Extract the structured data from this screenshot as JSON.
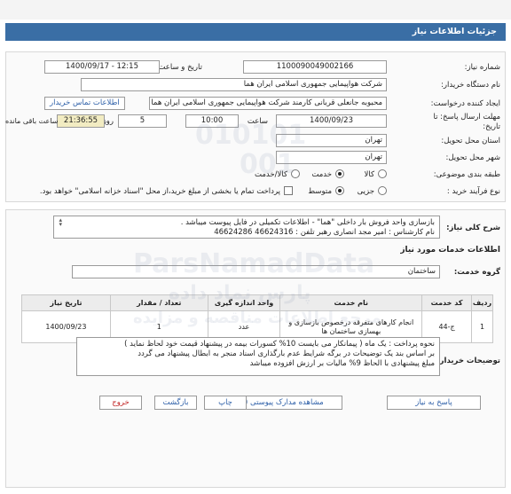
{
  "header": {
    "title": "جزئیات اطلاعات نیاز"
  },
  "form": {
    "need_number_label": "شماره نیاز:",
    "need_number": "1100090049002166",
    "announce_label": "تاریخ و ساعت اعلان عمومی:",
    "announce_value": "1400/09/17 - 12:15",
    "buyer_org_label": "نام دستگاه خریدار:",
    "buyer_org": "شرکت هواپیمایی جمهوری اسلامی ایران هما",
    "creator_label": "ایجاد کننده درخواست:",
    "creator": "محبوبه جانعلی قربانی کارمند شرکت هواپیمایی جمهوری اسلامی ایران هما",
    "contact_link": "اطلاعات تماس خریدار",
    "deadline_label_1": "مهلت ارسال پاسخ: تا",
    "deadline_label_2": "تاریخ:",
    "deadline_date": "1400/09/23",
    "time_label": "ساعت",
    "deadline_time": "10:00",
    "days_value": "5",
    "days_label": "روز و",
    "remaining_time": "21:36:55",
    "remaining_label": "ساعت باقی مانده",
    "province_label": "استان محل تحویل:",
    "province": "تهران",
    "city_label": "شهر محل تحویل:",
    "city": "تهران",
    "category_label": "طبقه بندی موضوعی:",
    "category_options": [
      "کالا",
      "خدمت",
      "کالا/خدمت"
    ],
    "category_selected": "خدمت",
    "purchase_label": "نوع فرآیند خرید :",
    "purchase_options": [
      "جزیی",
      "متوسط"
    ],
    "purchase_selected": "متوسط",
    "payment_note": "پرداخت تمام یا بخشی از مبلغ خرید،از محل \"اسناد خزانه اسلامی\" خواهد بود."
  },
  "description": {
    "label": "شرح کلی نیاز:",
    "line1": "بازسازی واحد فروش بار داخلی \"هما\" - اطلاعات تکمیلی در فایل پیوست میباشد .",
    "line2": "نام کارشناس : امیر مجد انصاری رهبر      تلفن : 46624316  46624286"
  },
  "services": {
    "section_title": "اطلاعات خدمات مورد نیاز",
    "group_label": "گروه خدمت:",
    "group_value": "ساختمان",
    "table": {
      "headers": [
        "ردیف",
        "کد خدمت",
        "نام خدمت",
        "واحد اندازه گیری",
        "تعداد / مقدار",
        "تاریخ نیاز"
      ],
      "rows": [
        [
          "1",
          "ج-44",
          "انجام کارهای متفرقه درخصوص بازسازی و بهسازی ساختمان ها",
          "عدد",
          "1",
          "1400/09/23"
        ]
      ]
    }
  },
  "buyer_notes": {
    "label": "توضیحات خریدار:",
    "line1": "نحوه پرداخت : یک ماه  ( پیمانکار می بایست 10% کسورات بیمه در پیشنهاد قیمت خود لحاظ نماید )",
    "line2": "بر اساس بند یک توضیحات در برگه شرایط عدم بارگذاری اسناد منجر به ابطال پیشنهاد می گردد",
    "line3": "مبلغ پیشنهادی با الحاظ 9% مالیات بر ارزش افزوده میباشد"
  },
  "buttons": {
    "reply": "پاسخ به نیاز",
    "attachments": "مشاهده مدارک پیوستی (1)",
    "print": "چاپ",
    "back": "بازگشت",
    "exit": "خروج"
  },
  "watermark": {
    "brand": "ParsNamadData",
    "persian": "پارس نماد داده",
    "sub": "مرجع اطلاعات مناقصه و مزایده",
    "digits1": "010101",
    "digits2": "001"
  },
  "colors": {
    "header_bg": "#3a6ea5",
    "link": "#2d5fa8",
    "exit_red": "#c02020",
    "remaining_bg": "#f2ecc2"
  }
}
